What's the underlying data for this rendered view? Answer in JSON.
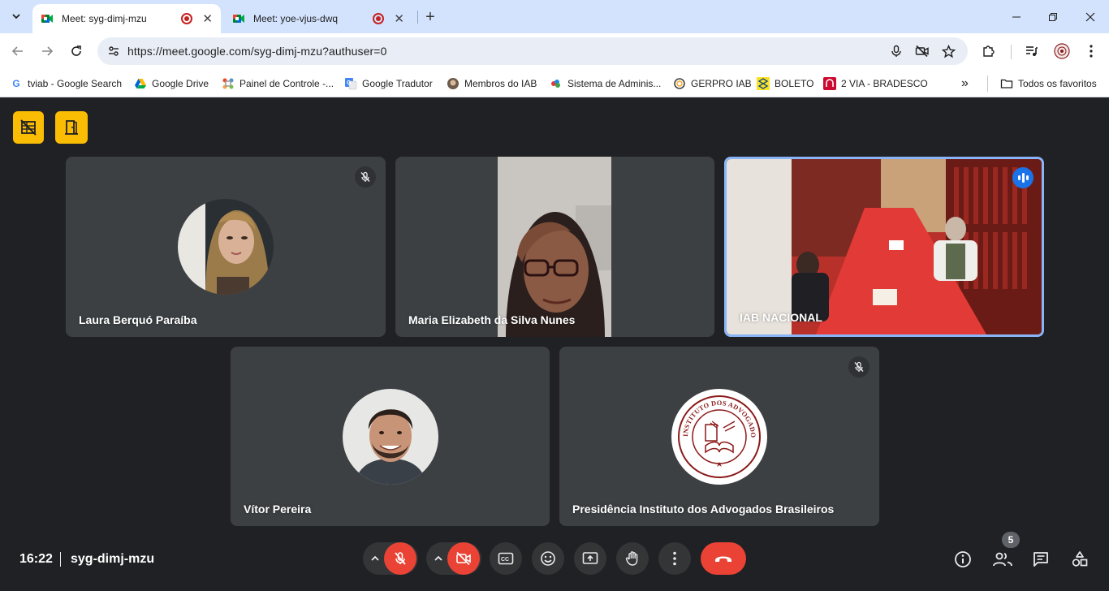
{
  "browser": {
    "tabs": [
      {
        "title": "Meet: syg-dimj-mzu",
        "active": true
      },
      {
        "title": "Meet: yoe-vjus-dwq",
        "active": false
      }
    ],
    "url": "https://meet.google.com/syg-dimj-mzu?authuser=0",
    "bookmarks": [
      "tviab - Google Search",
      "Google Drive",
      "Painel de Controle -...",
      "Google Tradutor",
      "Membros do IAB",
      "Sistema de Adminis...",
      "GERPRO IAB",
      "BOLETO",
      "2 VIA - BRADESCO"
    ],
    "all_bookmarks": "Todos os favoritos"
  },
  "participants": [
    {
      "name": "Laura Berquó Paraíba",
      "muted": true
    },
    {
      "name": "Maria Elizabeth da Silva Nunes",
      "muted": false
    },
    {
      "name": "IAB NACIONAL",
      "muted": false,
      "speaking": true
    },
    {
      "name": "Vítor Pereira",
      "muted": false
    },
    {
      "name": "Presidência Instituto dos Advogados Brasileiros",
      "muted": true
    }
  ],
  "logo_text": {
    "top": "INSTITUTO DOS ADVOGADOS BRASILEIROS"
  },
  "meeting": {
    "time": "16:22",
    "code": "syg-dimj-mzu",
    "participant_count": "5"
  },
  "colors": {
    "accent_yellow": "#fbbc04",
    "mic_off_red": "#ea4335",
    "speaking_blue": "#8ab4f8",
    "tile_bg": "#3c4043",
    "stage_bg": "#202124"
  }
}
